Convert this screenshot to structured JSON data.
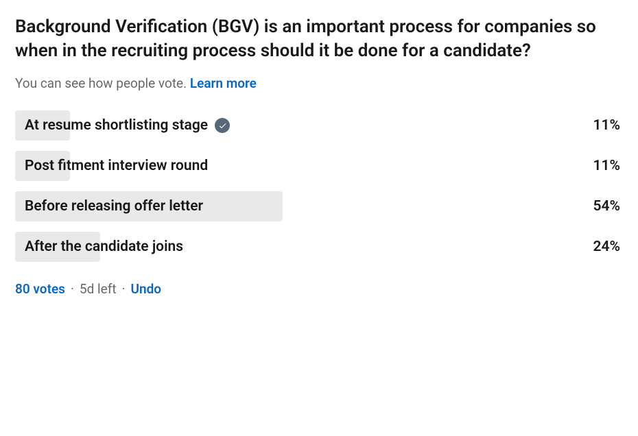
{
  "poll": {
    "question": "Background Verification (BGV) is an important process for companies so when in the recruiting process should it be done for a candidate?",
    "subtext": "You can see how people vote.",
    "learn_more": "Learn more",
    "options": [
      {
        "label": "At resume shortlisting stage",
        "percent": "11%",
        "bar_width": "9%",
        "voted": true
      },
      {
        "label": "Post fitment interview round",
        "percent": "11%",
        "bar_width": "9%",
        "voted": false
      },
      {
        "label": "Before releasing offer letter",
        "percent": "54%",
        "bar_width": "44%",
        "voted": false
      },
      {
        "label": "After the candidate joins",
        "percent": "24%",
        "bar_width": "14%",
        "voted": false
      }
    ],
    "votes_label": "80 votes",
    "time_left": "5d left",
    "undo_label": "Undo"
  },
  "chart_data": {
    "type": "bar",
    "categories": [
      "At resume shortlisting stage",
      "Post fitment interview round",
      "Before releasing offer letter",
      "After the candidate joins"
    ],
    "values": [
      11,
      11,
      54,
      24
    ],
    "title": "Background Verification (BGV) is an important process for companies so when in the recruiting process should it be done for a candidate?",
    "xlabel": "",
    "ylabel": "Percent",
    "ylim": [
      0,
      100
    ]
  }
}
